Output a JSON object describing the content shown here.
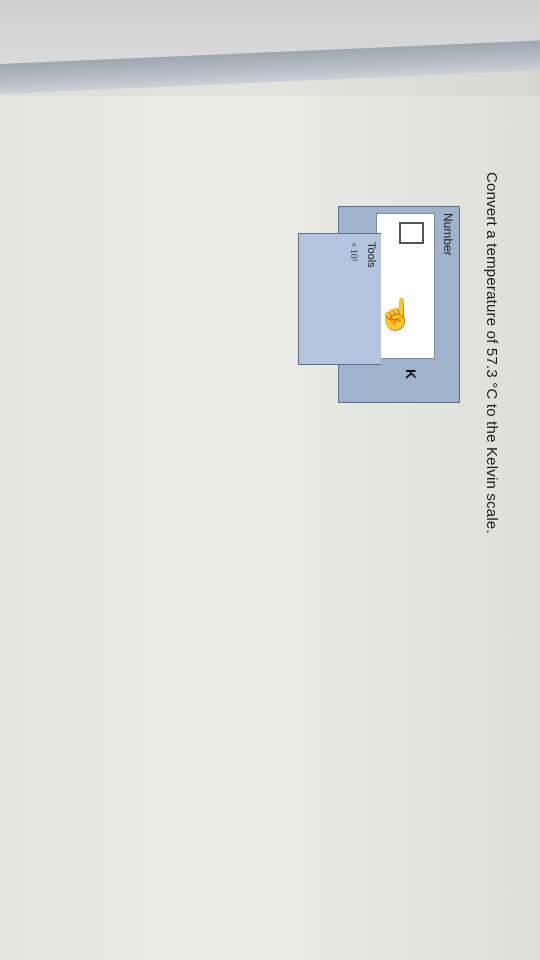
{
  "question": {
    "text": "Convert a temperature of 57.3 °C to the Kelvin scale."
  },
  "answer": {
    "number_label": "Number",
    "input_value": "",
    "unit": "K"
  },
  "tools": {
    "label": "Tools",
    "sci_notation_label": "× 10²"
  },
  "icons": {
    "pointer": "hand-pointer-icon"
  }
}
